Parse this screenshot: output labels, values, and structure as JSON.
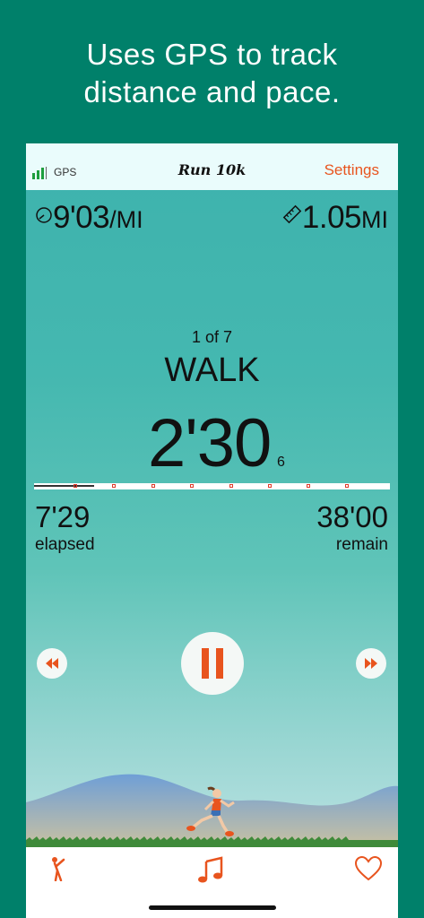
{
  "headline": {
    "line1": "Uses GPS to track",
    "line2": "distance and pace."
  },
  "statusbar": {
    "gps_label": "GPS",
    "title": "Run 10k",
    "settings_label": "Settings"
  },
  "metrics": {
    "pace_value": "9'03",
    "pace_unit": "/MI",
    "distance_value": "1.05",
    "distance_unit": "MI"
  },
  "interval": {
    "count": "1 of 7",
    "name": "WALK",
    "countdown": "2'30",
    "countdown_sub": "6"
  },
  "progress": {
    "fraction": 0.17
  },
  "times": {
    "elapsed_value": "7'29",
    "elapsed_label": "elapsed",
    "remain_value": "38'00",
    "remain_label": "remain"
  },
  "icons": {
    "gps": "signal-bars-icon",
    "pace": "stopwatch-icon",
    "distance": "ruler-icon",
    "rewind": "rewind-icon",
    "pause": "pause-icon",
    "forward": "fast-forward-icon",
    "tab_run": "stretching-runner-icon",
    "tab_music": "music-note-icon",
    "tab_heart": "heart-icon"
  },
  "colors": {
    "background": "#00806a",
    "accent": "#e8541e",
    "gps_bars": "#1e9e3e",
    "tick": "#e03a2a"
  }
}
